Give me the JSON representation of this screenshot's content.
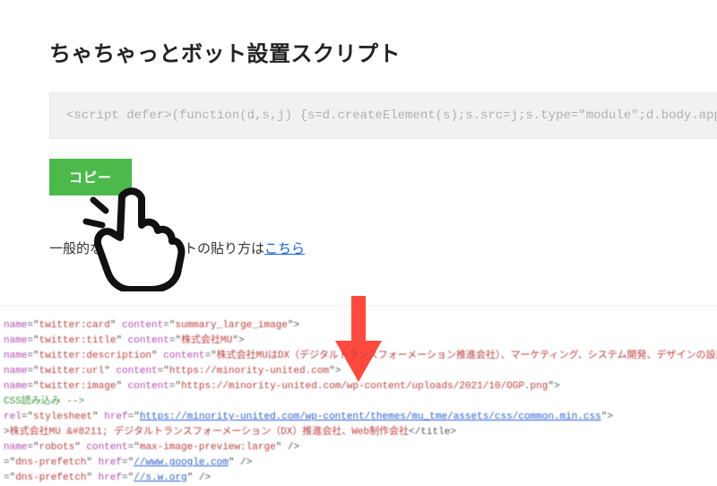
{
  "page": {
    "title": "ちゃちゃっとボット設置スクリプト"
  },
  "code": {
    "snippet": "<script defer>(function(d,s,j) {s=d.createElement(s);s.src=j;s.type=\"module\";d.body.apper"
  },
  "buttons": {
    "copy": "コピー"
  },
  "helper": {
    "prefix": "一般的な",
    "middle": "トの貼り方は",
    "link_text": "こちら",
    "link_href": "#"
  },
  "icons": {
    "hand": "pointing-hand-icon",
    "arrow": "down-arrow-icon"
  },
  "colors": {
    "copy_button": "#4bba4b",
    "arrow": "#ff4a3d"
  },
  "source_lines": [
    {
      "segments": [
        {
          "cls": "attr",
          "t": "name"
        },
        {
          "cls": "txt",
          "t": "=\""
        },
        {
          "cls": "val",
          "t": "twitter:card"
        },
        {
          "cls": "txt",
          "t": "\" "
        },
        {
          "cls": "attr",
          "t": "content"
        },
        {
          "cls": "txt",
          "t": "=\""
        },
        {
          "cls": "val",
          "t": "summary_large_image"
        },
        {
          "cls": "txt",
          "t": "\">"
        }
      ]
    },
    {
      "segments": [
        {
          "cls": "attr",
          "t": "name"
        },
        {
          "cls": "txt",
          "t": "=\""
        },
        {
          "cls": "val",
          "t": "twitter:title"
        },
        {
          "cls": "txt",
          "t": "\" "
        },
        {
          "cls": "attr",
          "t": "content"
        },
        {
          "cls": "txt",
          "t": "=\""
        },
        {
          "cls": "val",
          "t": "株式会社MU"
        },
        {
          "cls": "txt",
          "t": "\">"
        }
      ]
    },
    {
      "segments": [
        {
          "cls": "attr",
          "t": "name"
        },
        {
          "cls": "txt",
          "t": "=\""
        },
        {
          "cls": "val",
          "t": "twitter:description"
        },
        {
          "cls": "txt",
          "t": "\" "
        },
        {
          "cls": "attr",
          "t": "content"
        },
        {
          "cls": "txt",
          "t": "=\""
        },
        {
          "cls": "val",
          "t": "株式会社MUはDX（デジタルトランスフォーメーション推進会社）、マーケティング、システム開発、デザインの設計から実行までを"
        },
        {
          "cls": "txt",
          "t": ""
        }
      ]
    },
    {
      "segments": [
        {
          "cls": "attr",
          "t": "name"
        },
        {
          "cls": "txt",
          "t": "=\""
        },
        {
          "cls": "val",
          "t": "twitter:url"
        },
        {
          "cls": "txt",
          "t": "\" "
        },
        {
          "cls": "attr",
          "t": "content"
        },
        {
          "cls": "txt",
          "t": "=\""
        },
        {
          "cls": "val",
          "t": "https://minority-united.com"
        },
        {
          "cls": "txt",
          "t": "\">"
        }
      ]
    },
    {
      "segments": [
        {
          "cls": "attr",
          "t": "name"
        },
        {
          "cls": "txt",
          "t": "=\""
        },
        {
          "cls": "val",
          "t": "twitter:image"
        },
        {
          "cls": "txt",
          "t": "\" "
        },
        {
          "cls": "attr",
          "t": "content"
        },
        {
          "cls": "txt",
          "t": "=\""
        },
        {
          "cls": "val",
          "t": "https://minority-united.com/wp-content/uploads/2021/10/OGP.png"
        },
        {
          "cls": "txt",
          "t": "\">"
        }
      ]
    },
    {
      "segments": [
        {
          "cls": "cmt",
          "t": "CSS読み込み -->"
        }
      ]
    },
    {
      "segments": [
        {
          "cls": "attr",
          "t": "rel"
        },
        {
          "cls": "txt",
          "t": "=\""
        },
        {
          "cls": "val",
          "t": "stylesheet"
        },
        {
          "cls": "txt",
          "t": "\" "
        },
        {
          "cls": "attr",
          "t": "href"
        },
        {
          "cls": "txt",
          "t": "=\""
        },
        {
          "cls": "url",
          "t": "https://minority-united.com/wp-content/themes/mu_tme/assets/css/common.min.css"
        },
        {
          "cls": "txt",
          "t": "\">"
        }
      ]
    },
    {
      "segments": [
        {
          "cls": "txt",
          "t": ">"
        },
        {
          "cls": "val",
          "t": "株式会社MU &#8211; デジタルトランスフォーメーション（DX）推進会社、Web制作会社"
        },
        {
          "cls": "txt",
          "t": "</title>"
        }
      ]
    },
    {
      "segments": [
        {
          "cls": "attr",
          "t": "name"
        },
        {
          "cls": "txt",
          "t": "=\""
        },
        {
          "cls": "val",
          "t": "robots"
        },
        {
          "cls": "txt",
          "t": "\" "
        },
        {
          "cls": "attr",
          "t": "content"
        },
        {
          "cls": "txt",
          "t": "=\""
        },
        {
          "cls": "val",
          "t": "max-image-preview:large"
        },
        {
          "cls": "txt",
          "t": "\" />"
        }
      ]
    },
    {
      "segments": [
        {
          "cls": "txt",
          "t": "=\""
        },
        {
          "cls": "val",
          "t": "dns-prefetch"
        },
        {
          "cls": "txt",
          "t": "\" "
        },
        {
          "cls": "attr",
          "t": "href"
        },
        {
          "cls": "txt",
          "t": "=\""
        },
        {
          "cls": "url",
          "t": "//www.google.com"
        },
        {
          "cls": "txt",
          "t": "\" />"
        }
      ]
    },
    {
      "segments": [
        {
          "cls": "txt",
          "t": "=\""
        },
        {
          "cls": "val",
          "t": "dns-prefetch"
        },
        {
          "cls": "txt",
          "t": "\" "
        },
        {
          "cls": "attr",
          "t": "href"
        },
        {
          "cls": "txt",
          "t": "=\""
        },
        {
          "cls": "url",
          "t": "//s.w.org"
        },
        {
          "cls": "txt",
          "t": "\" />"
        }
      ]
    }
  ]
}
